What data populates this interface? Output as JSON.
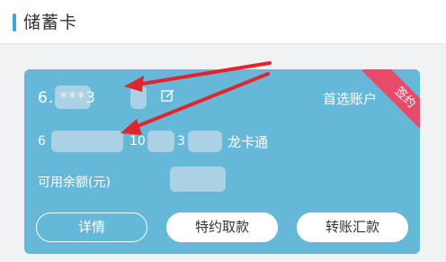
{
  "header": {
    "title": "储蓄卡"
  },
  "card": {
    "account_number": "6.  ***3",
    "preferred_label": "首选账户",
    "signed_badge": "签约",
    "card_number_start": "6",
    "card_number_mid": "10",
    "card_number_part3": "3",
    "card_name": "龙卡通",
    "balance_label": "可用余额(元)",
    "background_color": "#66b8d9",
    "badge_color": "#e84a6a"
  },
  "buttons": {
    "detail": "详情",
    "special_withdraw": "特约取款",
    "transfer": "转账汇款"
  },
  "annotations": {
    "arrow_color": "#e0262c"
  }
}
